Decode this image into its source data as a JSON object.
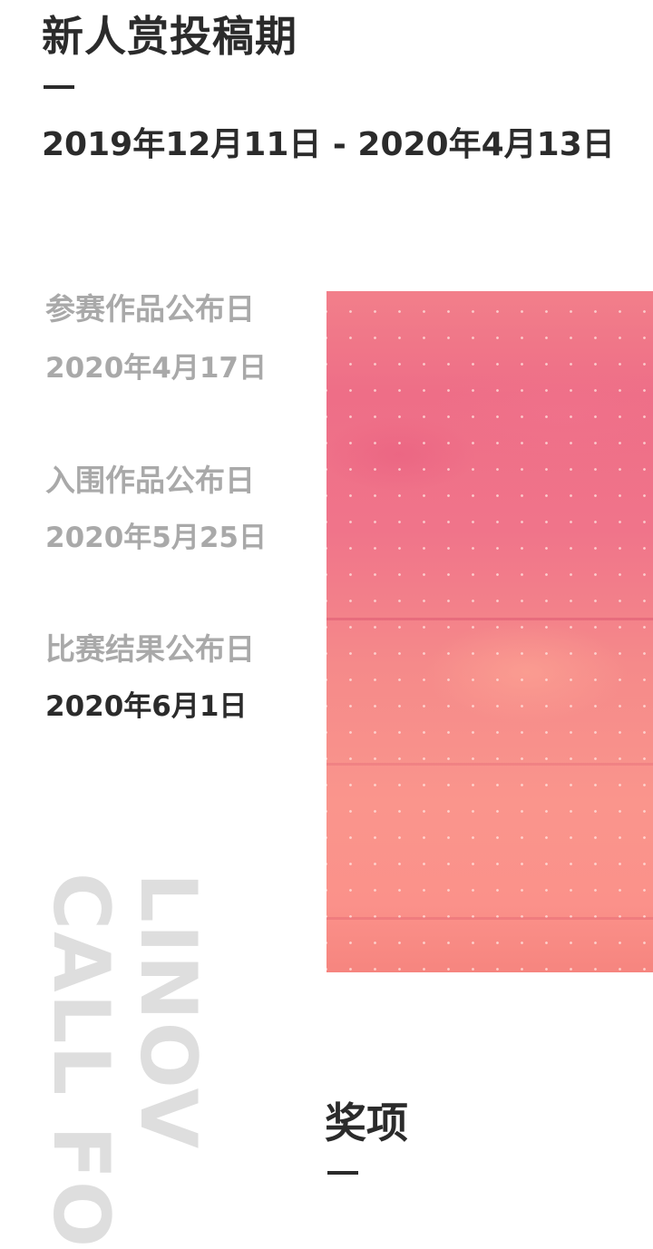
{
  "header": {
    "title": "新人赏投稿期",
    "period": "2019年12月11日 - 2020年4月13日"
  },
  "schedule": [
    {
      "label": "参赛作品公布日",
      "date": "2020年4月17日",
      "active": false
    },
    {
      "label": "入围作品公布日",
      "date": "2020年5月25日",
      "active": false
    },
    {
      "label": "比赛结果公布日",
      "date": "2020年6月1日",
      "active": true
    }
  ],
  "watermark": {
    "line1": "LINOV",
    "line2": "CALL FO"
  },
  "awards": {
    "title": "奖项"
  },
  "colors": {
    "text_dark": "#2b2b2b",
    "text_muted": "#a9a9a9",
    "watermark": "#dedede",
    "art_pink": "#ee6e87",
    "art_coral": "#fa958c"
  }
}
